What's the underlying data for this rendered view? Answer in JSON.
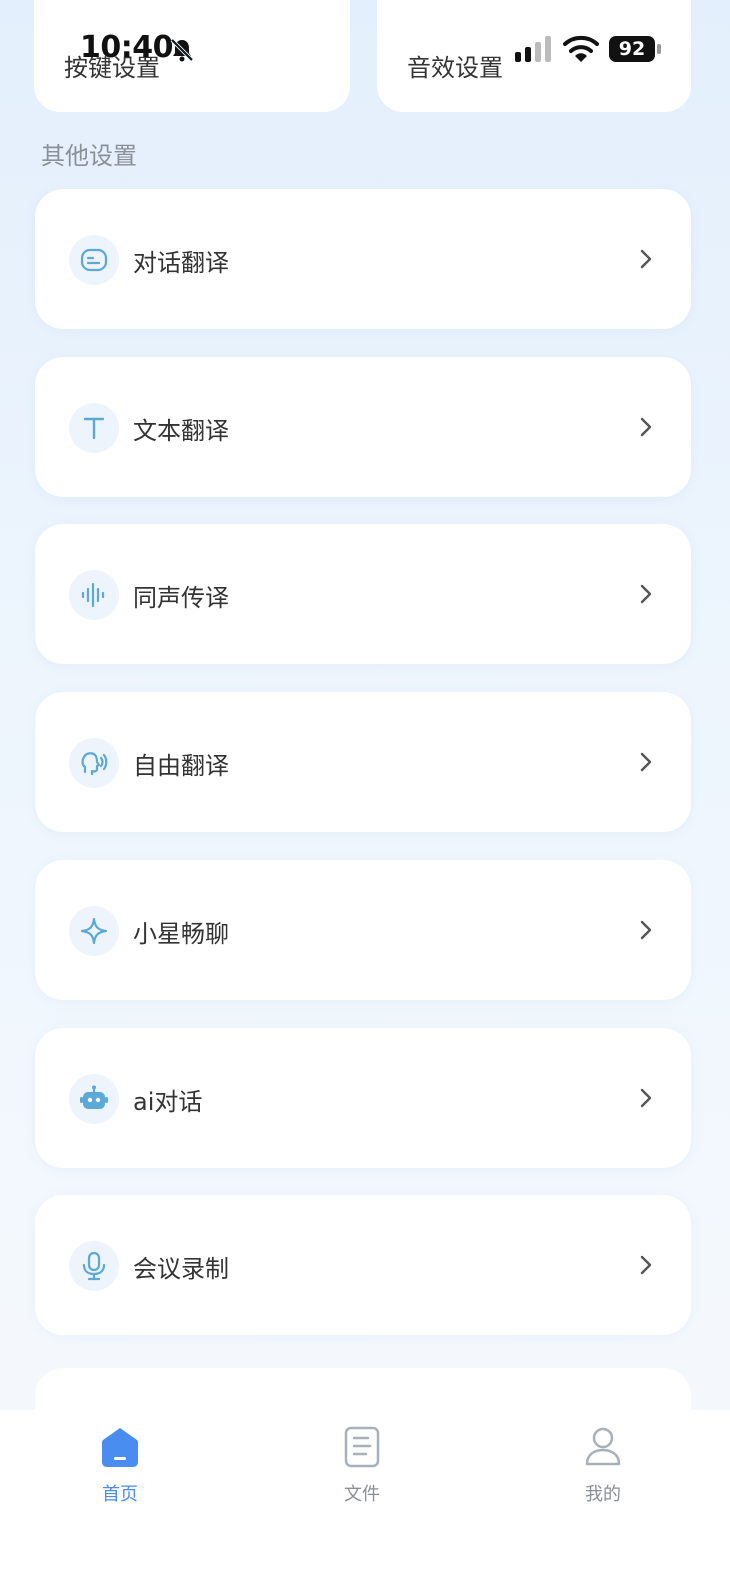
{
  "status_bar": {
    "time": "10:40",
    "battery": "92"
  },
  "top_cards": {
    "left_label": "按键设置",
    "right_label": "音效设置"
  },
  "section": {
    "title": "其他设置"
  },
  "menu": {
    "items": [
      {
        "label": "对话翻译",
        "icon": "chat-bubble-icon"
      },
      {
        "label": "文本翻译",
        "icon": "text-t-icon"
      },
      {
        "label": "同声传译",
        "icon": "sound-wave-icon"
      },
      {
        "label": "自由翻译",
        "icon": "speaking-head-icon"
      },
      {
        "label": "小星畅聊",
        "icon": "sparkle-star-icon"
      },
      {
        "label": "ai对话",
        "icon": "robot-icon"
      },
      {
        "label": "会议录制",
        "icon": "microphone-icon"
      }
    ]
  },
  "tabbar": {
    "home": "首页",
    "files": "文件",
    "mine": "我的"
  },
  "colors": {
    "accent": "#4a8df0",
    "icon": "#5aa9d6",
    "inactive": "#8a8f96"
  }
}
